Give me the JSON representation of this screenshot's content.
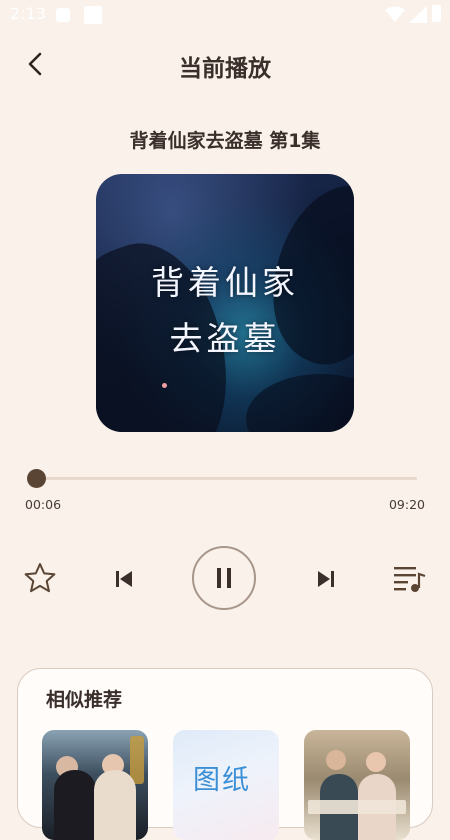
{
  "status_bar": {
    "time": "2:13"
  },
  "header": {
    "title": "当前播放"
  },
  "episode": {
    "title": "背着仙家去盗墓 第1集"
  },
  "cover": {
    "line1": "背着仙家",
    "line2": "去盗墓"
  },
  "player": {
    "current_time": "00:06",
    "total_time": "09:20",
    "progress_fraction": 0.011,
    "state": "playing"
  },
  "icons": {
    "back": "chevron-left-icon",
    "favorite": "star-icon",
    "previous": "skip-previous-icon",
    "pause": "pause-icon",
    "next": "skip-next-icon",
    "playlist": "playlist-icon"
  },
  "colors": {
    "background": "#f9f1ea",
    "accent": "#5a4535",
    "track": "#e8d7cb"
  },
  "recommend": {
    "title": "相似推荐",
    "items": [
      {
        "cover_text": ""
      },
      {
        "cover_text": "图纸"
      },
      {
        "cover_text": ""
      }
    ]
  }
}
